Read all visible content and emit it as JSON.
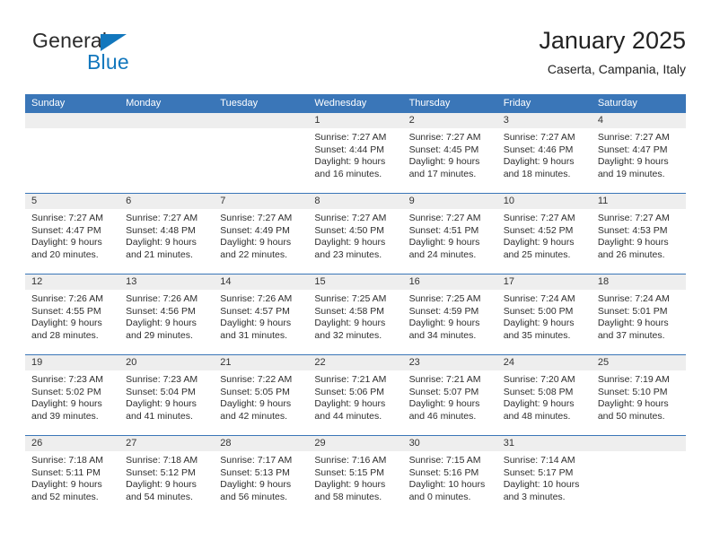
{
  "brand": {
    "word_one": "General",
    "word_two": "Blue",
    "flag_icon": "triangle-flag-icon"
  },
  "header": {
    "title": "January 2025",
    "subtitle": "Caserta, Campania, Italy"
  },
  "colors": {
    "header_blue": "#3a76b8",
    "brand_blue": "#1277bd",
    "daynum_band": "#eeeeee",
    "text": "#222222"
  },
  "weekdays": [
    "Sunday",
    "Monday",
    "Tuesday",
    "Wednesday",
    "Thursday",
    "Friday",
    "Saturday"
  ],
  "weeks": [
    [
      {
        "day": "",
        "lines": []
      },
      {
        "day": "",
        "lines": []
      },
      {
        "day": "",
        "lines": []
      },
      {
        "day": "1",
        "lines": [
          "Sunrise: 7:27 AM",
          "Sunset: 4:44 PM",
          "Daylight: 9 hours",
          "and 16 minutes."
        ]
      },
      {
        "day": "2",
        "lines": [
          "Sunrise: 7:27 AM",
          "Sunset: 4:45 PM",
          "Daylight: 9 hours",
          "and 17 minutes."
        ]
      },
      {
        "day": "3",
        "lines": [
          "Sunrise: 7:27 AM",
          "Sunset: 4:46 PM",
          "Daylight: 9 hours",
          "and 18 minutes."
        ]
      },
      {
        "day": "4",
        "lines": [
          "Sunrise: 7:27 AM",
          "Sunset: 4:47 PM",
          "Daylight: 9 hours",
          "and 19 minutes."
        ]
      }
    ],
    [
      {
        "day": "5",
        "lines": [
          "Sunrise: 7:27 AM",
          "Sunset: 4:47 PM",
          "Daylight: 9 hours",
          "and 20 minutes."
        ]
      },
      {
        "day": "6",
        "lines": [
          "Sunrise: 7:27 AM",
          "Sunset: 4:48 PM",
          "Daylight: 9 hours",
          "and 21 minutes."
        ]
      },
      {
        "day": "7",
        "lines": [
          "Sunrise: 7:27 AM",
          "Sunset: 4:49 PM",
          "Daylight: 9 hours",
          "and 22 minutes."
        ]
      },
      {
        "day": "8",
        "lines": [
          "Sunrise: 7:27 AM",
          "Sunset: 4:50 PM",
          "Daylight: 9 hours",
          "and 23 minutes."
        ]
      },
      {
        "day": "9",
        "lines": [
          "Sunrise: 7:27 AM",
          "Sunset: 4:51 PM",
          "Daylight: 9 hours",
          "and 24 minutes."
        ]
      },
      {
        "day": "10",
        "lines": [
          "Sunrise: 7:27 AM",
          "Sunset: 4:52 PM",
          "Daylight: 9 hours",
          "and 25 minutes."
        ]
      },
      {
        "day": "11",
        "lines": [
          "Sunrise: 7:27 AM",
          "Sunset: 4:53 PM",
          "Daylight: 9 hours",
          "and 26 minutes."
        ]
      }
    ],
    [
      {
        "day": "12",
        "lines": [
          "Sunrise: 7:26 AM",
          "Sunset: 4:55 PM",
          "Daylight: 9 hours",
          "and 28 minutes."
        ]
      },
      {
        "day": "13",
        "lines": [
          "Sunrise: 7:26 AM",
          "Sunset: 4:56 PM",
          "Daylight: 9 hours",
          "and 29 minutes."
        ]
      },
      {
        "day": "14",
        "lines": [
          "Sunrise: 7:26 AM",
          "Sunset: 4:57 PM",
          "Daylight: 9 hours",
          "and 31 minutes."
        ]
      },
      {
        "day": "15",
        "lines": [
          "Sunrise: 7:25 AM",
          "Sunset: 4:58 PM",
          "Daylight: 9 hours",
          "and 32 minutes."
        ]
      },
      {
        "day": "16",
        "lines": [
          "Sunrise: 7:25 AM",
          "Sunset: 4:59 PM",
          "Daylight: 9 hours",
          "and 34 minutes."
        ]
      },
      {
        "day": "17",
        "lines": [
          "Sunrise: 7:24 AM",
          "Sunset: 5:00 PM",
          "Daylight: 9 hours",
          "and 35 minutes."
        ]
      },
      {
        "day": "18",
        "lines": [
          "Sunrise: 7:24 AM",
          "Sunset: 5:01 PM",
          "Daylight: 9 hours",
          "and 37 minutes."
        ]
      }
    ],
    [
      {
        "day": "19",
        "lines": [
          "Sunrise: 7:23 AM",
          "Sunset: 5:02 PM",
          "Daylight: 9 hours",
          "and 39 minutes."
        ]
      },
      {
        "day": "20",
        "lines": [
          "Sunrise: 7:23 AM",
          "Sunset: 5:04 PM",
          "Daylight: 9 hours",
          "and 41 minutes."
        ]
      },
      {
        "day": "21",
        "lines": [
          "Sunrise: 7:22 AM",
          "Sunset: 5:05 PM",
          "Daylight: 9 hours",
          "and 42 minutes."
        ]
      },
      {
        "day": "22",
        "lines": [
          "Sunrise: 7:21 AM",
          "Sunset: 5:06 PM",
          "Daylight: 9 hours",
          "and 44 minutes."
        ]
      },
      {
        "day": "23",
        "lines": [
          "Sunrise: 7:21 AM",
          "Sunset: 5:07 PM",
          "Daylight: 9 hours",
          "and 46 minutes."
        ]
      },
      {
        "day": "24",
        "lines": [
          "Sunrise: 7:20 AM",
          "Sunset: 5:08 PM",
          "Daylight: 9 hours",
          "and 48 minutes."
        ]
      },
      {
        "day": "25",
        "lines": [
          "Sunrise: 7:19 AM",
          "Sunset: 5:10 PM",
          "Daylight: 9 hours",
          "and 50 minutes."
        ]
      }
    ],
    [
      {
        "day": "26",
        "lines": [
          "Sunrise: 7:18 AM",
          "Sunset: 5:11 PM",
          "Daylight: 9 hours",
          "and 52 minutes."
        ]
      },
      {
        "day": "27",
        "lines": [
          "Sunrise: 7:18 AM",
          "Sunset: 5:12 PM",
          "Daylight: 9 hours",
          "and 54 minutes."
        ]
      },
      {
        "day": "28",
        "lines": [
          "Sunrise: 7:17 AM",
          "Sunset: 5:13 PM",
          "Daylight: 9 hours",
          "and 56 minutes."
        ]
      },
      {
        "day": "29",
        "lines": [
          "Sunrise: 7:16 AM",
          "Sunset: 5:15 PM",
          "Daylight: 9 hours",
          "and 58 minutes."
        ]
      },
      {
        "day": "30",
        "lines": [
          "Sunrise: 7:15 AM",
          "Sunset: 5:16 PM",
          "Daylight: 10 hours",
          "and 0 minutes."
        ]
      },
      {
        "day": "31",
        "lines": [
          "Sunrise: 7:14 AM",
          "Sunset: 5:17 PM",
          "Daylight: 10 hours",
          "and 3 minutes."
        ]
      },
      {
        "day": "",
        "lines": []
      }
    ]
  ]
}
